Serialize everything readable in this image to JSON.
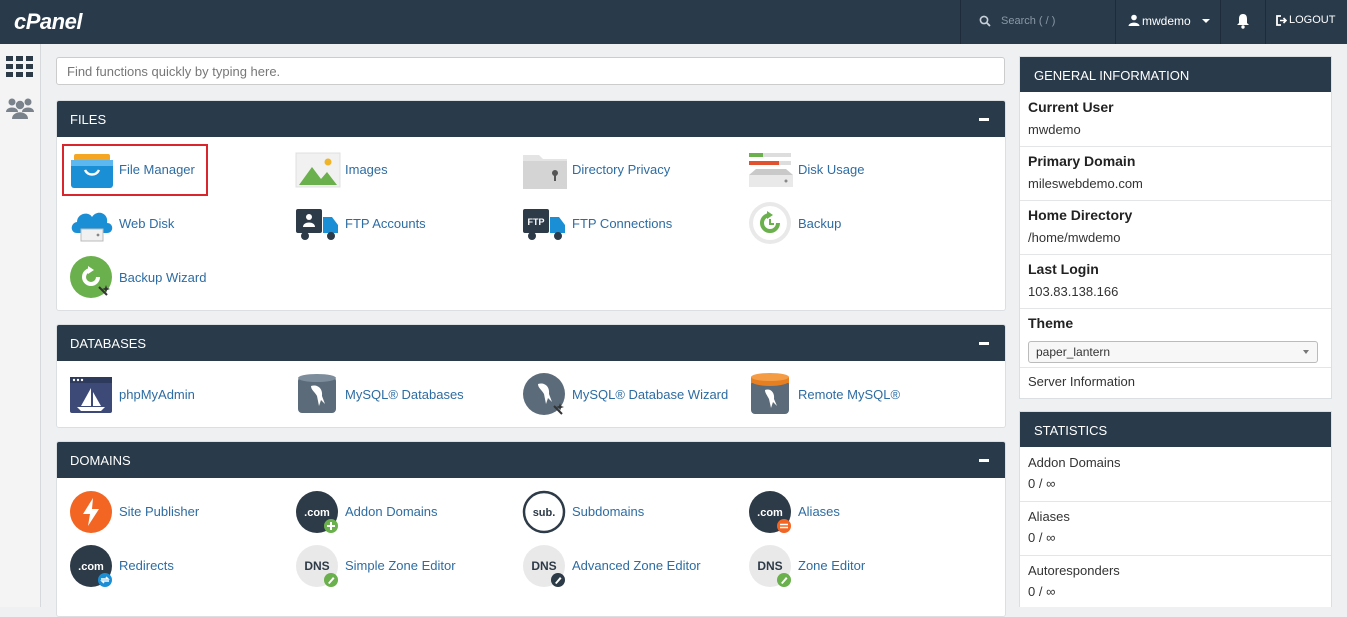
{
  "topbar": {
    "logo": "cPanel",
    "search_placeholder": "Search ( / )",
    "username": "mwdemo",
    "logout_label": "LOGOUT"
  },
  "quick_search": {
    "placeholder": "Find functions quickly by typing here."
  },
  "sections": {
    "files": {
      "title": "FILES",
      "items": [
        {
          "label": "File Manager",
          "icon": "file-manager-icon"
        },
        {
          "label": "Images",
          "icon": "images-icon"
        },
        {
          "label": "Directory Privacy",
          "icon": "directory-privacy-icon"
        },
        {
          "label": "Disk Usage",
          "icon": "disk-usage-icon"
        },
        {
          "label": "Web Disk",
          "icon": "web-disk-icon"
        },
        {
          "label": "FTP Accounts",
          "icon": "ftp-accounts-icon"
        },
        {
          "label": "FTP Connections",
          "icon": "ftp-connections-icon"
        },
        {
          "label": "Backup",
          "icon": "backup-icon"
        },
        {
          "label": "Backup Wizard",
          "icon": "backup-wizard-icon"
        }
      ]
    },
    "databases": {
      "title": "DATABASES",
      "items": [
        {
          "label": "phpMyAdmin",
          "icon": "phpmyadmin-icon"
        },
        {
          "label": "MySQL® Databases",
          "icon": "mysql-databases-icon"
        },
        {
          "label": "MySQL® Database Wizard",
          "icon": "mysql-wizard-icon"
        },
        {
          "label": "Remote MySQL®",
          "icon": "remote-mysql-icon"
        }
      ]
    },
    "domains": {
      "title": "DOMAINS",
      "items": [
        {
          "label": "Site Publisher",
          "icon": "site-publisher-icon"
        },
        {
          "label": "Addon Domains",
          "icon": "addon-domains-icon",
          "badge": ".com"
        },
        {
          "label": "Subdomains",
          "icon": "subdomains-icon",
          "badge": "sub."
        },
        {
          "label": "Aliases",
          "icon": "aliases-icon",
          "badge": ".com"
        },
        {
          "label": "Redirects",
          "icon": "redirects-icon",
          "badge": ".com"
        },
        {
          "label": "Simple Zone Editor",
          "icon": "simple-zone-editor-icon",
          "badge": "DNS"
        },
        {
          "label": "Advanced Zone Editor",
          "icon": "advanced-zone-editor-icon",
          "badge": "DNS"
        },
        {
          "label": "Zone Editor",
          "icon": "zone-editor-icon",
          "badge": "DNS"
        }
      ]
    }
  },
  "general_info": {
    "title": "GENERAL INFORMATION",
    "current_user_label": "Current User",
    "current_user": "mwdemo",
    "primary_domain_label": "Primary Domain",
    "primary_domain": "mileswebdemo.com",
    "home_directory_label": "Home Directory",
    "home_directory": "/home/mwdemo",
    "last_login_label": "Last Login",
    "last_login": "103.83.138.166",
    "theme_label": "Theme",
    "theme_value": "paper_lantern",
    "server_info_link": "Server Information"
  },
  "statistics": {
    "title": "STATISTICS",
    "rows": [
      {
        "label": "Addon Domains",
        "value": "0 / ∞"
      },
      {
        "label": "Aliases",
        "value": "0 / ∞"
      },
      {
        "label": "Autoresponders",
        "value": "0 / ∞"
      }
    ]
  }
}
